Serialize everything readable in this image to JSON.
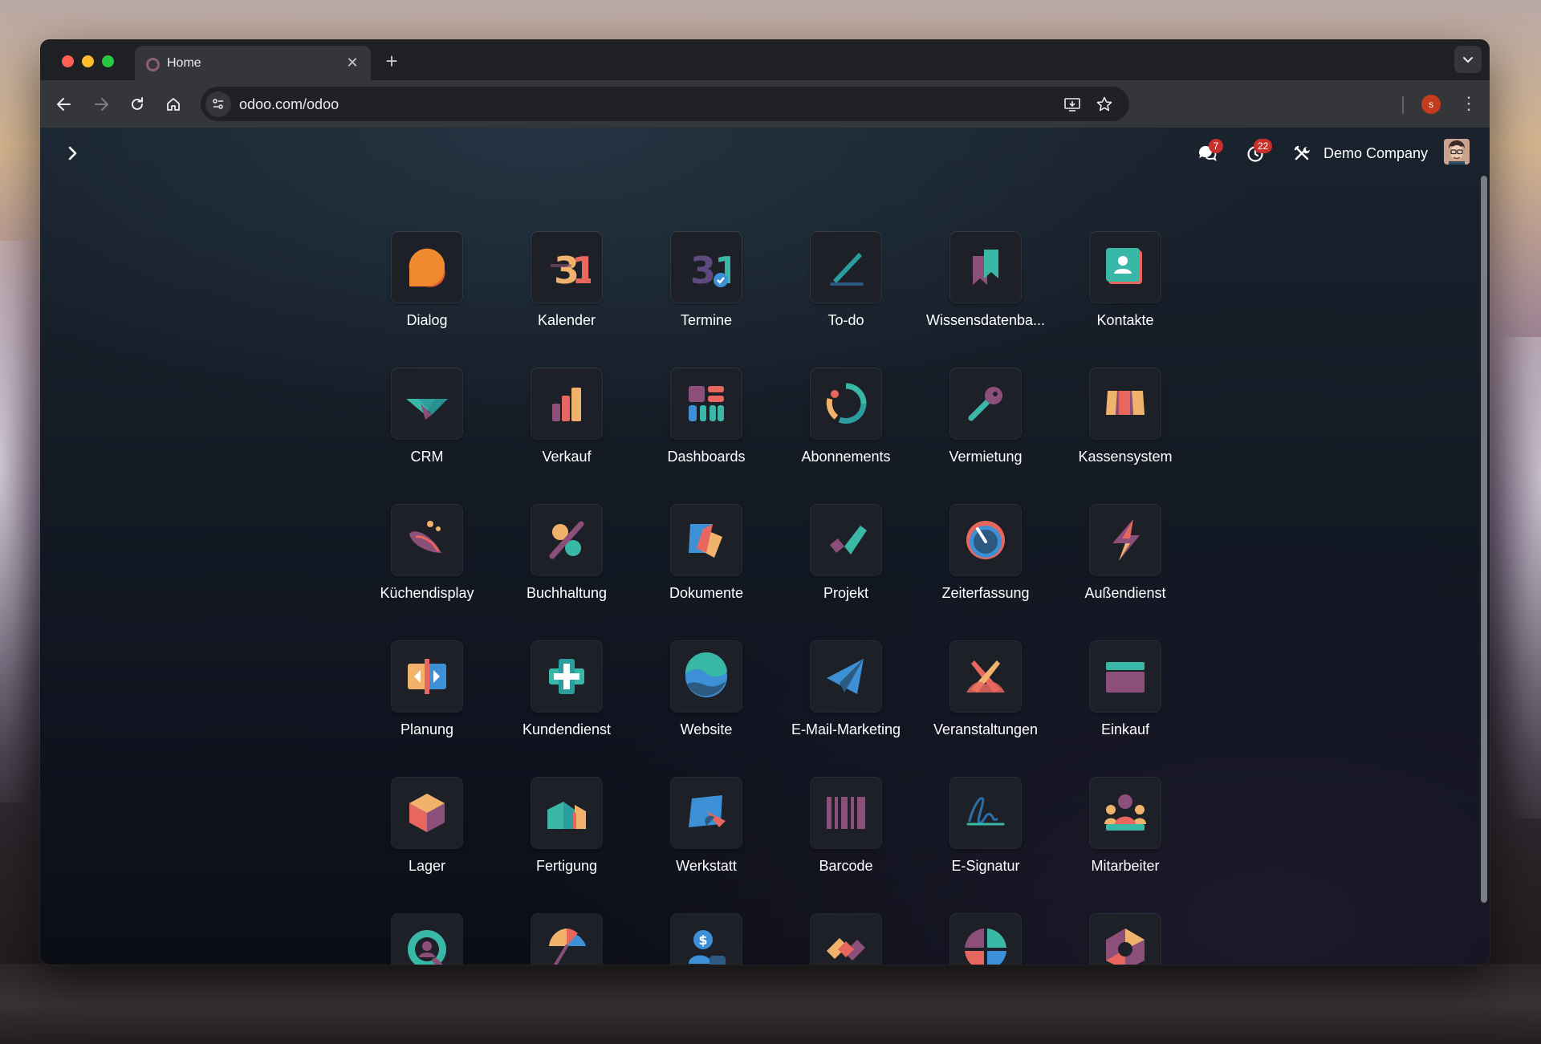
{
  "browser": {
    "tab_title": "Home",
    "tab_close": "✕",
    "new_tab": "+",
    "url": "odoo.com/odoo",
    "profile_initial": "s",
    "menu": "⋮"
  },
  "navbar": {
    "messages_badge": "7",
    "activities_badge": "22",
    "company": "Demo Company"
  },
  "apps": [
    {
      "label": "Dialog",
      "icon": "discuss-icon"
    },
    {
      "label": "Kalender",
      "icon": "calendar-icon"
    },
    {
      "label": "Termine",
      "icon": "appointments-icon"
    },
    {
      "label": "To-do",
      "icon": "todo-icon"
    },
    {
      "label": "Wissensdatenba...",
      "icon": "knowledge-icon"
    },
    {
      "label": "Kontakte",
      "icon": "contacts-icon"
    },
    {
      "label": "CRM",
      "icon": "crm-icon"
    },
    {
      "label": "Verkauf",
      "icon": "sales-icon"
    },
    {
      "label": "Dashboards",
      "icon": "dashboards-icon"
    },
    {
      "label": "Abonnements",
      "icon": "subscriptions-icon"
    },
    {
      "label": "Vermietung",
      "icon": "rental-icon"
    },
    {
      "label": "Kassensystem",
      "icon": "point-of-sale-icon"
    },
    {
      "label": "Küchendisplay",
      "icon": "kitchen-display-icon"
    },
    {
      "label": "Buchhaltung",
      "icon": "accounting-icon"
    },
    {
      "label": "Dokumente",
      "icon": "documents-icon"
    },
    {
      "label": "Projekt",
      "icon": "project-icon"
    },
    {
      "label": "Zeiterfassung",
      "icon": "timesheets-icon"
    },
    {
      "label": "Außendienst",
      "icon": "field-service-icon"
    },
    {
      "label": "Planung",
      "icon": "planning-icon"
    },
    {
      "label": "Kundendienst",
      "icon": "helpdesk-icon"
    },
    {
      "label": "Website",
      "icon": "website-icon"
    },
    {
      "label": "E-Mail-Marketing",
      "icon": "email-marketing-icon"
    },
    {
      "label": "Veranstaltungen",
      "icon": "events-icon"
    },
    {
      "label": "Einkauf",
      "icon": "purchase-icon"
    },
    {
      "label": "Lager",
      "icon": "inventory-icon"
    },
    {
      "label": "Fertigung",
      "icon": "manufacturing-icon"
    },
    {
      "label": "Werkstatt",
      "icon": "repairs-icon"
    },
    {
      "label": "Barcode",
      "icon": "barcode-icon"
    },
    {
      "label": "E-Signatur",
      "icon": "sign-icon"
    },
    {
      "label": "Mitarbeiter",
      "icon": "employees-icon"
    },
    {
      "label": "",
      "icon": "recruitment-icon"
    },
    {
      "label": "",
      "icon": "time-off-icon"
    },
    {
      "label": "",
      "icon": "payroll-icon"
    },
    {
      "label": "",
      "icon": "referrals-icon"
    },
    {
      "label": "",
      "icon": "appraisals-icon"
    },
    {
      "label": "",
      "icon": "fleet-icon"
    }
  ]
}
